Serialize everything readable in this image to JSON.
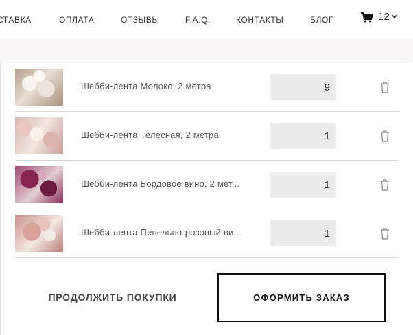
{
  "nav": {
    "items": [
      {
        "label": "СТАВКА"
      },
      {
        "label": "ОПЛАТА"
      },
      {
        "label": "ОТЗЫВЫ"
      },
      {
        "label": "F.A.Q."
      },
      {
        "label": "КОНТАКТЫ"
      },
      {
        "label": "БЛОГ"
      }
    ],
    "cart": {
      "icon": "cart-icon",
      "count": "12",
      "chevron": "chevron-down-icon"
    }
  },
  "cart_items": [
    {
      "name": "Шебби-лента Молоко, 2 метра",
      "quantity": "9",
      "thumb_colors": [
        "#efe9e4",
        "#d9cbbf",
        "#b7a390"
      ],
      "delete_icon": "trash-icon"
    },
    {
      "name": "Шебби-лента Телесная, 2 метра",
      "quantity": "1",
      "thumb_colors": [
        "#e4c9c4",
        "#f3ece6",
        "#cfa6a0"
      ],
      "delete_icon": "trash-icon"
    },
    {
      "name": "Шебби-лента Бордовое вино, 2 мет...",
      "quantity": "1",
      "thumb_colors": [
        "#7a2248",
        "#b05a7d",
        "#e5c9cf"
      ],
      "delete_icon": "trash-icon"
    },
    {
      "name": "Шебби-лента Пепельно-розовый ви...",
      "quantity": "1",
      "thumb_colors": [
        "#e7c2bd",
        "#cf9f98",
        "#f4ebe4"
      ],
      "delete_icon": "trash-icon"
    }
  ],
  "actions": {
    "continue_label": "ПРОДОЛЖИТЬ ПОКУПКИ",
    "checkout_label": "ОФОРМИТЬ ЗАКАЗ"
  },
  "colors": {
    "accent": "#111111",
    "qty_bg": "#ebebeb",
    "divider": "#d9d9d9"
  }
}
